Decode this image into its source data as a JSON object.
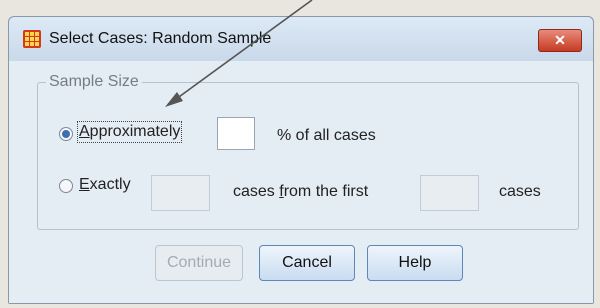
{
  "window": {
    "title": "Select Cases: Random Sample",
    "close_label": "✕"
  },
  "group": {
    "legend": "Sample Size"
  },
  "approx": {
    "label_first": "A",
    "label_rest": "pproximately",
    "value": "",
    "suffix": "% of all cases",
    "selected": true
  },
  "exactly": {
    "label_first": "E",
    "label_rest": "xactly",
    "count_value": "",
    "middle_before": "cases ",
    "middle_accel": "f",
    "middle_after": "rom the first",
    "first_value": "",
    "suffix": "cases",
    "selected": false
  },
  "buttons": {
    "continue": "Continue",
    "cancel": "Cancel",
    "help": "Help"
  },
  "colors": {
    "close_button": "#c63b23",
    "radio_selected": "#3c6eb4",
    "annotation_arrow": "#555555"
  }
}
